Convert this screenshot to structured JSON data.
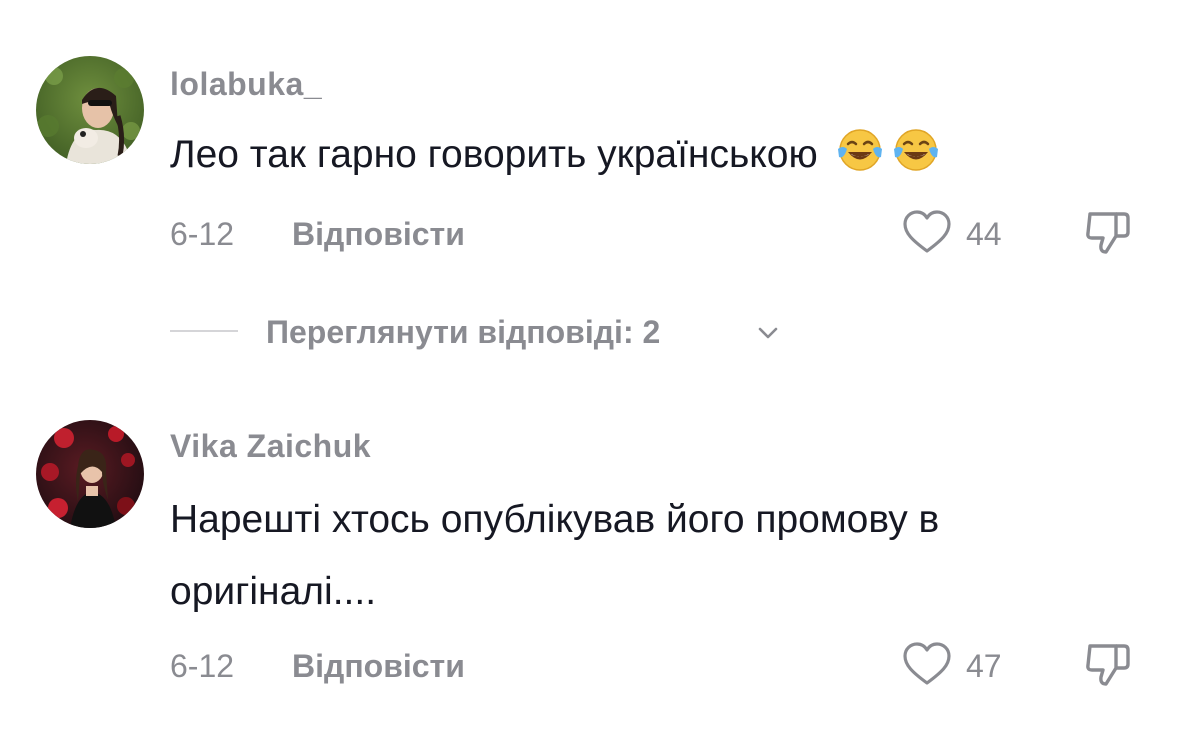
{
  "comments": [
    {
      "username": "lolabuka_",
      "text": "Лео так гарно говорить українською",
      "emojis": [
        "face-with-tears-of-joy-icon",
        "face-with-tears-of-joy-icon"
      ],
      "date": "6-12",
      "reply_label": "Відповісти",
      "likes": "44",
      "view_replies_label": "Переглянути відповіді: 2"
    },
    {
      "username": "Vika Zaichuk",
      "text": "Нарешті хтось опублікував його промову в оригіналі....",
      "date": "6-12",
      "reply_label": "Відповісти",
      "likes": "47"
    }
  ],
  "icons": {
    "like": "heart-outline-icon",
    "dislike": "thumbs-down-icon",
    "expand": "chevron-down-icon"
  },
  "colors": {
    "text": "#161823",
    "secondary": "#8a8b91",
    "divider": "#d5d5d8"
  }
}
